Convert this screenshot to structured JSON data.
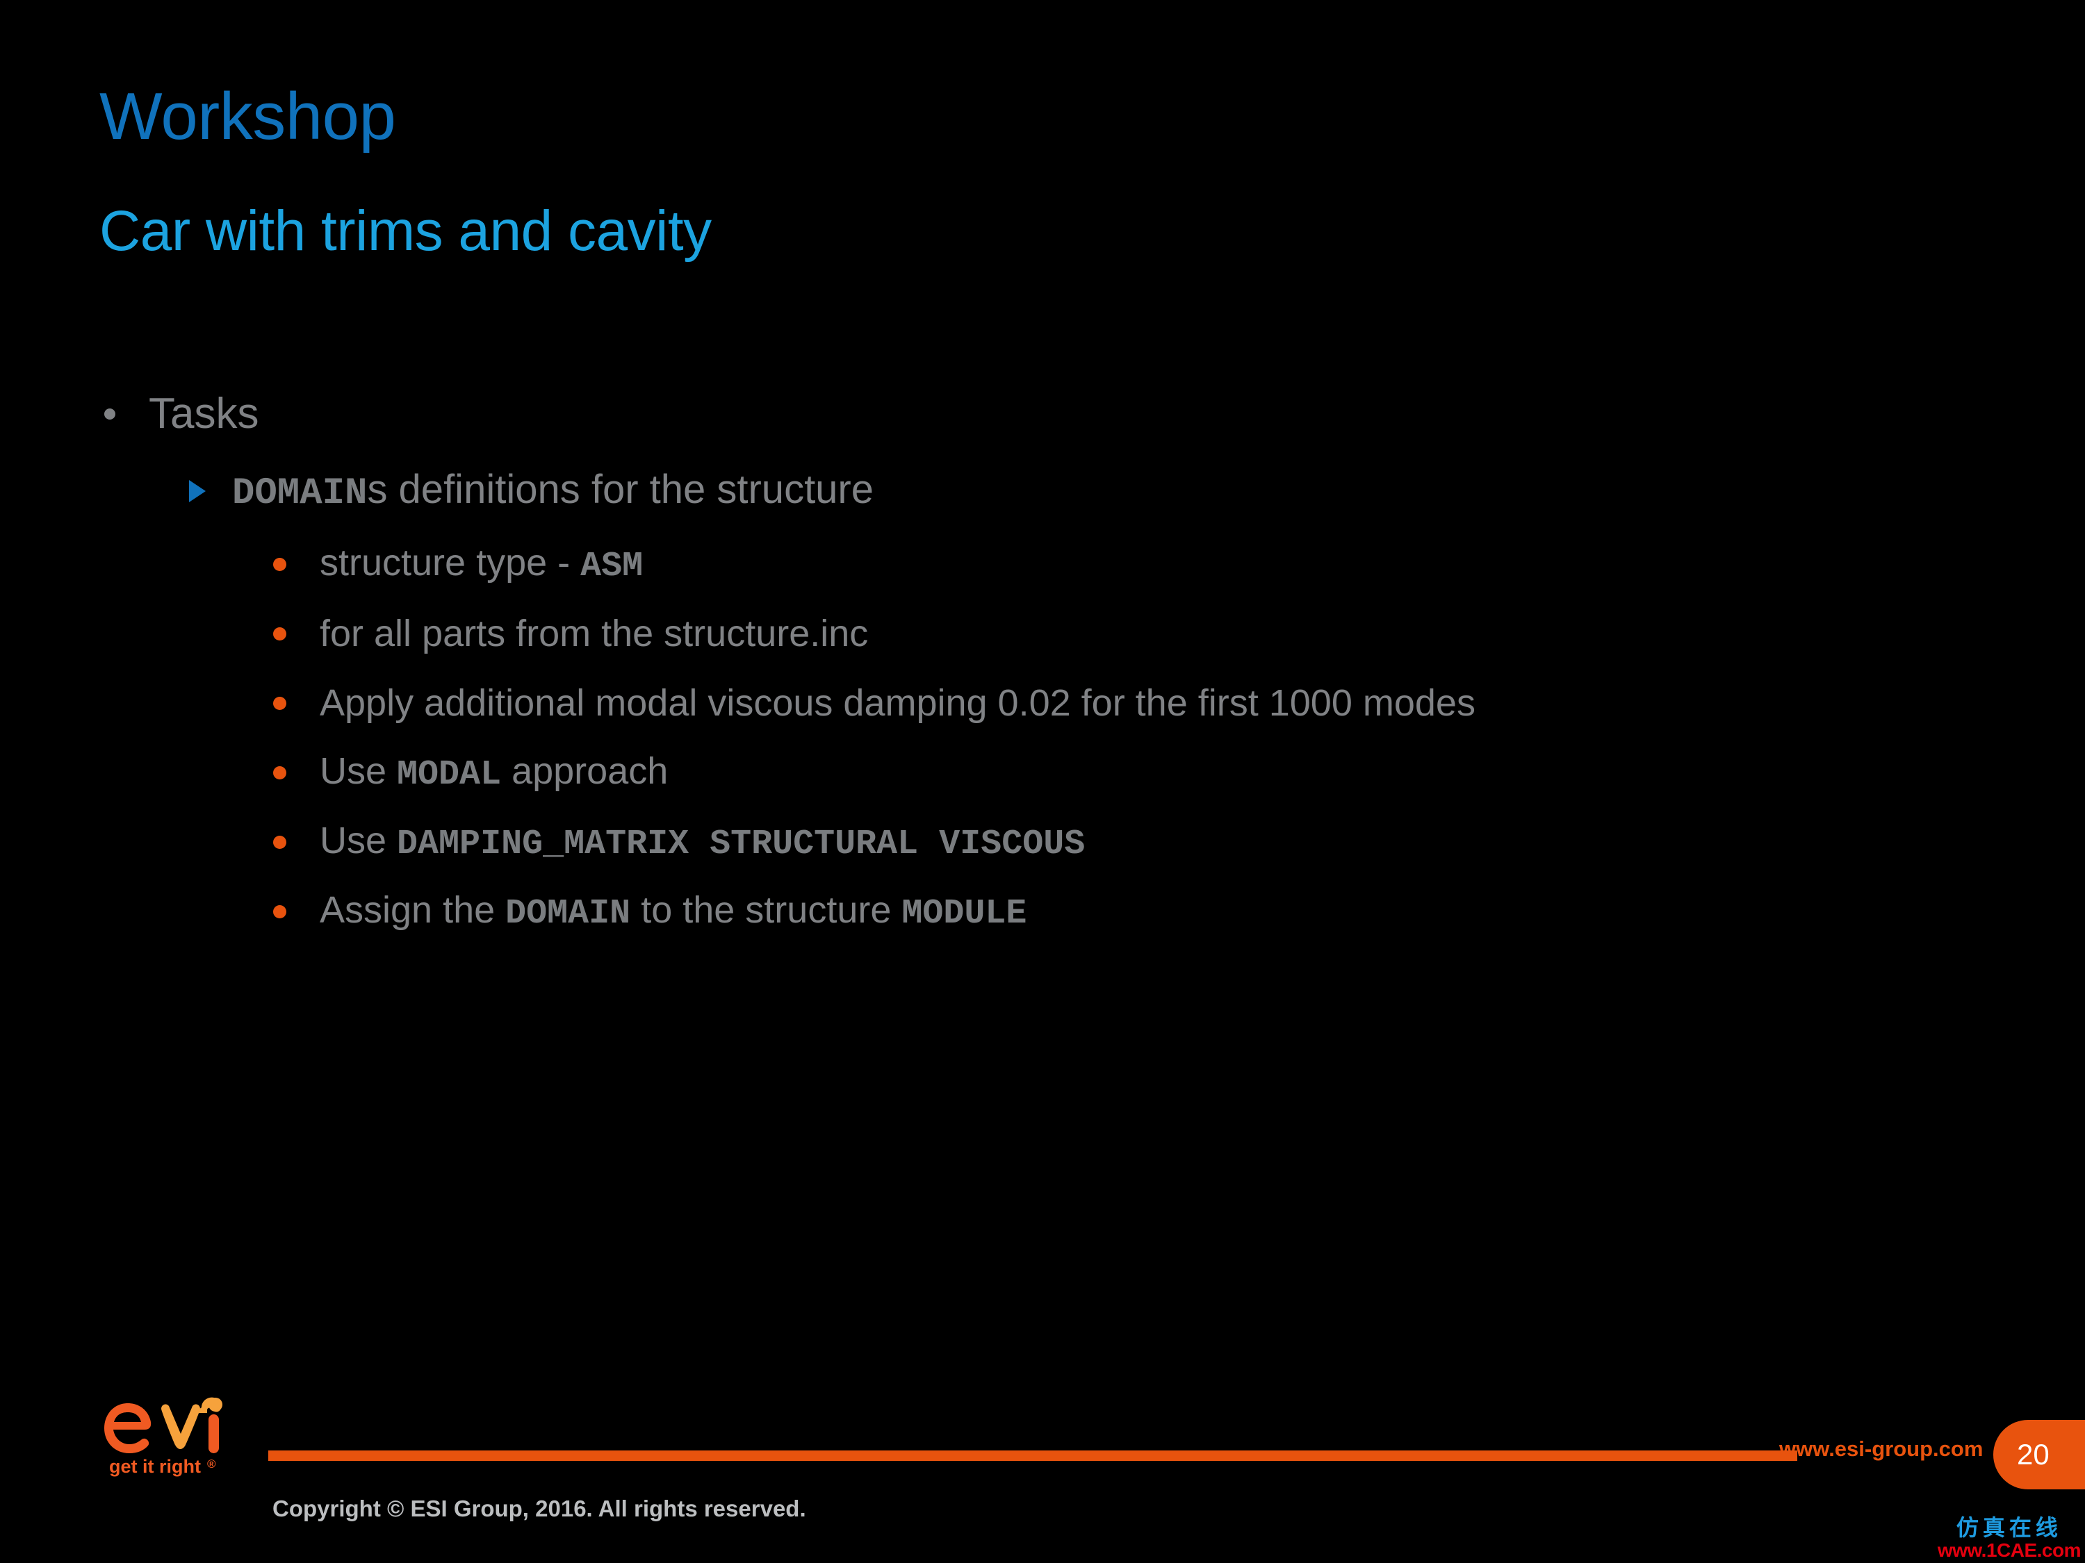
{
  "slide": {
    "title": "Workshop",
    "subtitle": "Car with trims and cavity",
    "title_color": "#1072BC",
    "subtitle_color": "#1CA3E0",
    "background_color": "#000000",
    "accent_color": "#E8530E",
    "body_text_color": "#808285"
  },
  "outline": {
    "level1": {
      "text": "Tasks",
      "bullet": "grey-dot-bullet"
    },
    "level2": {
      "bullet": "blue-triangle-bullet",
      "keyword": "DOMAIN",
      "rest": "s definitions for the structure"
    },
    "level3": [
      {
        "bullet": "orange-dot-bullet",
        "pre": "structure type - ",
        "keyword": "ASM",
        "post": ""
      },
      {
        "bullet": "orange-dot-bullet",
        "pre": "for all parts from the structure.inc",
        "keyword": "",
        "post": ""
      },
      {
        "bullet": "orange-dot-bullet",
        "pre": "Apply additional modal viscous damping 0.02 for the first 1000 modes",
        "keyword": "",
        "post": ""
      },
      {
        "bullet": "orange-dot-bullet",
        "pre": "Use ",
        "keyword": "MODAL",
        "post": " approach"
      },
      {
        "bullet": "orange-dot-bullet",
        "pre": "Use ",
        "keyword": "DAMPING_MATRIX STRUCTURAL VISCOUS",
        "post": ""
      },
      {
        "bullet": "orange-dot-bullet",
        "pre": "Assign the ",
        "keyword": "DOMAIN",
        "post": " to the structure ",
        "keyword2": "MODULE"
      }
    ]
  },
  "footer": {
    "logo_wordmark": "esi",
    "logo_tagline": "get it right®",
    "website": "www.esi-group.com",
    "page_number": "20",
    "copyright": "Copyright © ESI Group, 2016. All rights reserved."
  },
  "watermark": {
    "cn_text": "仿真在线",
    "en_text": "www.1CAE.com",
    "cn_color": "#1E9BE0",
    "en_color": "#E4000F"
  }
}
